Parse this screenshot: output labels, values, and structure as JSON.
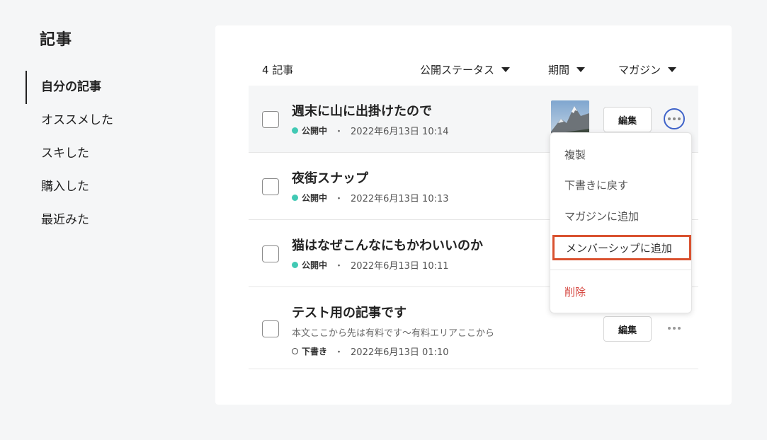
{
  "sidebar": {
    "title": "記事",
    "items": [
      {
        "label": "自分の記事",
        "active": true
      },
      {
        "label": "オススメした"
      },
      {
        "label": "スキした"
      },
      {
        "label": "購入した"
      },
      {
        "label": "最近みた"
      }
    ]
  },
  "toolbar": {
    "count": "4 記事",
    "filters": [
      "公開ステータス",
      "期間",
      "マガジン"
    ]
  },
  "articles": [
    {
      "title": "週末に山に出掛けたので",
      "status": "公開中",
      "date": "2022年6月13日 10:14",
      "edit": "編集",
      "has_thumbnail": true
    },
    {
      "title": "夜街スナップ",
      "status": "公開中",
      "date": "2022年6月13日 10:13"
    },
    {
      "title": "猫はなぜこんなにもかわいいのか",
      "status": "公開中",
      "date": "2022年6月13日 10:11"
    },
    {
      "title": "テスト用の記事です",
      "excerpt": "本文ここから先は有料です〜有料エリアここから",
      "status": "下書き",
      "date": "2022年6月13日 01:10",
      "edit": "編集"
    }
  ],
  "menu": {
    "items": [
      "複製",
      "下書きに戻す",
      "マガジンに追加",
      "メンバーシップに追加",
      "削除"
    ],
    "highlighted": "メンバーシップに追加"
  },
  "colors": {
    "published_dot": "#41c9b4",
    "highlight_border": "#d9512f",
    "delete_text": "#d64a43",
    "active_more_ring": "#3f63c9"
  }
}
